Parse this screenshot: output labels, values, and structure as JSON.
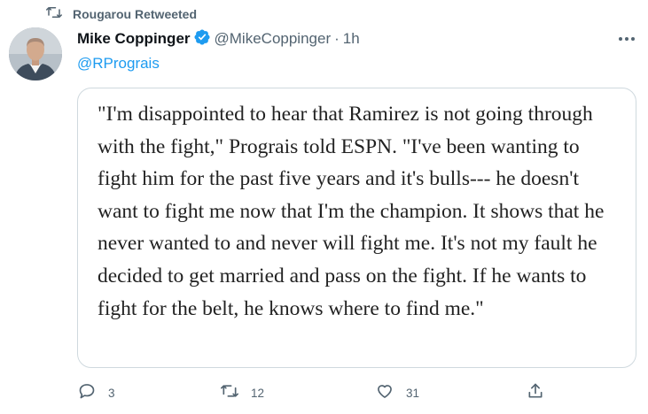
{
  "retweet": {
    "icon": "retweet-icon",
    "label": "Rougarou Retweeted"
  },
  "author": {
    "avatar": "avatar-icon",
    "name": "Mike Coppinger",
    "verified_icon": "verified-badge-icon",
    "handle": "@MikeCoppinger",
    "separator": "·",
    "time": "1h"
  },
  "more_icon": "more-dots-icon",
  "reply_to": "@RPrograis",
  "quote_text": "\"I'm disappointed to hear that Ramirez is not going through with the fight,\" Prograis told ESPN. \"I've been wanting to fight him for the past five years and it's bulls--- he doesn't want to fight me now that I'm the champion. It shows that he never wanted to and never will fight me. It's not my fault he decided to get married and pass on the fight. If he wants to fight for the belt, he knows where to find me.\"",
  "actions": {
    "reply": {
      "icon": "reply-icon",
      "count": "3"
    },
    "retweet": {
      "icon": "retweet-icon",
      "count": "12"
    },
    "like": {
      "icon": "heart-icon",
      "count": "31"
    },
    "share": {
      "icon": "share-icon"
    }
  },
  "colors": {
    "accent": "#1d9bf0",
    "secondary_text": "#536471",
    "primary_text": "#0f1419",
    "card_border": "#cfd9de"
  }
}
